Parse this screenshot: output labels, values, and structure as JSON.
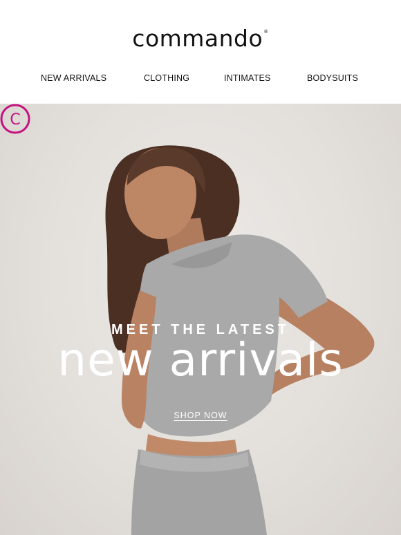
{
  "brand": {
    "logo_text": "commando",
    "trademark": "®"
  },
  "nav": {
    "items": [
      {
        "label": "NEW ARRIVALS"
      },
      {
        "label": "CLOTHING"
      },
      {
        "label": "INTIMATES"
      },
      {
        "label": "BODYSUITS"
      }
    ]
  },
  "hero": {
    "eyebrow": "MEET THE LATEST",
    "headline": "new arrivals",
    "cta_label": "SHOP NOW",
    "badge_letter": "C"
  },
  "colors": {
    "text": "#111111",
    "accent": "#c4137f",
    "hero_bg": "#e3dfdb",
    "overlay_text": "#ffffff"
  }
}
